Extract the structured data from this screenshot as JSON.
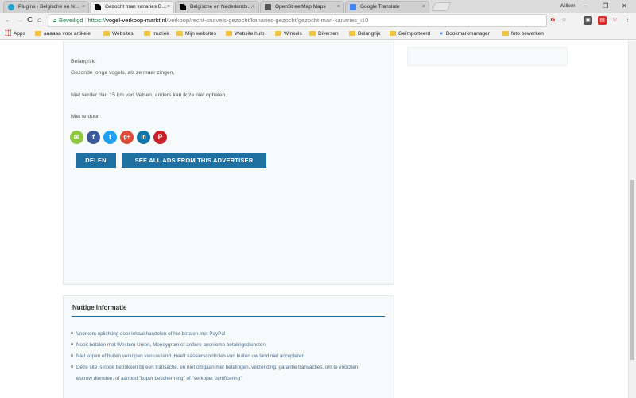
{
  "browser": {
    "tabs": [
      {
        "label": "Plugins ‹ Belgische en N…",
        "favicon_color": "#21a0d2"
      },
      {
        "label": "Gezocht man kanaries B…",
        "favicon_color": "#000000"
      },
      {
        "label": "Belgische en Nederlands…",
        "favicon_color": "#000000"
      },
      {
        "label": "OpenStreetMap Maps",
        "favicon_color": "#555555"
      },
      {
        "label": "Google Translate",
        "favicon_color": "#4285f4"
      }
    ],
    "tab_close": "×",
    "user": "Willem",
    "window_controls": {
      "minimize": "–",
      "restore": "❐",
      "close": "✕"
    },
    "nav": {
      "back": "←",
      "forward": "→",
      "reload": "C",
      "home": "⌂"
    },
    "address": {
      "secure_label": "Beveiligd",
      "scheme": "https://",
      "domain": "vogel-verkoop-markt.nl",
      "path": "/verkoop/recht-snavels-gezocht/kanaries-gezocht/gezocht-man-kanaries_i10"
    },
    "bookmarks": [
      {
        "label": "Apps",
        "kind": "apps"
      },
      {
        "label": "aaaaaa voor artikele",
        "kind": "folder"
      },
      {
        "label": "Websites",
        "kind": "folder"
      },
      {
        "label": "muziek",
        "kind": "folder"
      },
      {
        "label": "Mijn websites",
        "kind": "folder"
      },
      {
        "label": "Website hulp",
        "kind": "folder"
      },
      {
        "label": "Winkels",
        "kind": "folder"
      },
      {
        "label": "Diversen",
        "kind": "folder"
      },
      {
        "label": "Belangrijk",
        "kind": "folder"
      },
      {
        "label": "Geïmporteerd",
        "kind": "folder"
      },
      {
        "label": "Bookmarkmanager",
        "kind": "star"
      },
      {
        "label": "foto bewerken",
        "kind": "folder"
      }
    ]
  },
  "ad": {
    "lines": [
      "Belangrijk:",
      "Gezonde jonge vogels, als ze maar zingen.",
      "Niet verder dan 15 km van Velsen, anders kan ik ze niet ophalen.",
      "Niet te duur."
    ],
    "share": [
      {
        "name": "email-share-icon",
        "glyph": "✉",
        "color": "#8dc63f"
      },
      {
        "name": "facebook-share-icon",
        "glyph": "f",
        "color": "#3b5998"
      },
      {
        "name": "twitter-share-icon",
        "glyph": "t",
        "color": "#1da1f2"
      },
      {
        "name": "googleplus-share-icon",
        "glyph": "g+",
        "color": "#dd4b39"
      },
      {
        "name": "linkedin-share-icon",
        "glyph": "in",
        "color": "#0e76a8"
      },
      {
        "name": "pinterest-share-icon",
        "glyph": "P",
        "color": "#cb2027"
      }
    ],
    "share_button": "DELEN",
    "all_ads_button": "SEE ALL ADS FROM THIS ADVERTISER"
  },
  "info": {
    "title": "Nuttige Informatie",
    "items": [
      "Voorkom oplichting door lokaal handelen of het betalen met PayPal",
      "Nooit betalen met Western Union, Moneygram of andere anonieme betalingsdiensten",
      "Niet kopen of buiten verkopen van uw land. Heeft kassierscontroles van buiten uw land niet accepteren",
      "Deze site is nooit betrokken bij een transactie, en niet omgaan met betalingen, verzending, garantie transacties, om te voorzien",
      "escrow diensten, of aanbod \"koper bescherming\" of \"verkoper certificering\""
    ]
  }
}
